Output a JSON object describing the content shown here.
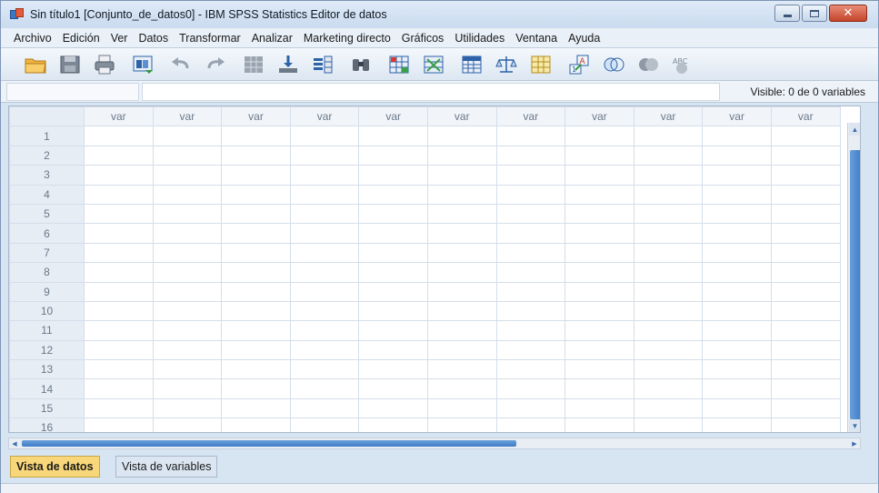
{
  "window": {
    "title": "Sin título1 [Conjunto_de_datos0] - IBM SPSS Statistics Editor de datos",
    "close_glyph": "✕"
  },
  "menu": [
    "Archivo",
    "Edición",
    "Ver",
    "Datos",
    "Transformar",
    "Analizar",
    "Marketing directo",
    "Gráficos",
    "Utilidades",
    "Ventana",
    "Ayuda"
  ],
  "toolbar": {
    "icons": [
      "open-folder-icon",
      "save-icon",
      "print-icon",
      "dialog-recall-icon",
      "undo-icon",
      "redo-icon",
      "goto-case-icon",
      "goto-variable-icon",
      "variables-icon",
      "find-icon",
      "insert-cases-icon",
      "insert-variable-icon",
      "split-file-icon",
      "weight-cases-icon",
      "select-cases-icon",
      "value-labels-icon",
      "use-sets-icon",
      "show-all-variables-icon",
      "spell-check-icon"
    ],
    "spell_label": "ABC"
  },
  "editor": {
    "visible_label": "Visible: 0 de 0 variables"
  },
  "grid": {
    "column_headers": [
      "var",
      "var",
      "var",
      "var",
      "var",
      "var",
      "var",
      "var",
      "var",
      "var",
      "var"
    ],
    "row_numbers": [
      "1",
      "2",
      "3",
      "4",
      "5",
      "6",
      "7",
      "8",
      "9",
      "10",
      "11",
      "12",
      "13",
      "14",
      "15",
      "16"
    ]
  },
  "tabs": {
    "data_view": "Vista de datos",
    "variable_view": "Vista de variables"
  },
  "colors": {
    "active_tab": "#f7d77a",
    "scroll_thumb": "#3f7dc7"
  }
}
